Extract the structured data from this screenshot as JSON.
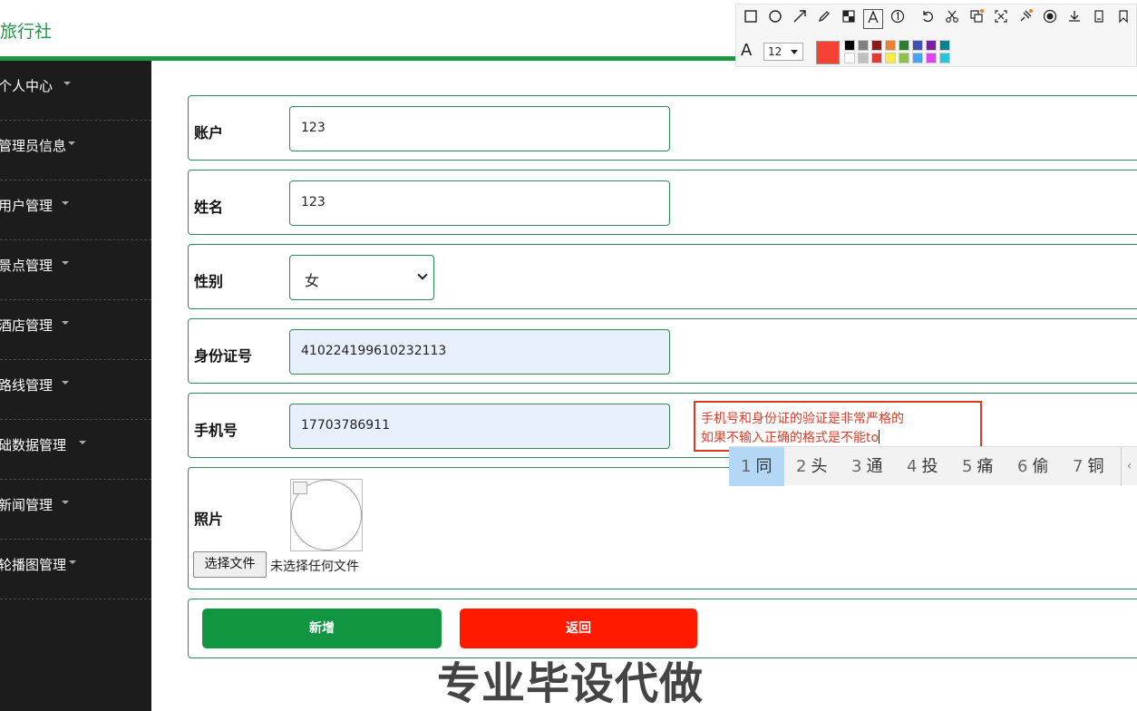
{
  "header": {
    "brand": "旅行社",
    "accent_color": "#1f9646"
  },
  "sidebar": {
    "items": [
      {
        "label": "个人中心"
      },
      {
        "label": "管理员信息"
      },
      {
        "label": "用户管理"
      },
      {
        "label": "景点管理"
      },
      {
        "label": "酒店管理"
      },
      {
        "label": "路线管理"
      },
      {
        "label": "础数据管理"
      },
      {
        "label": "新闻管理"
      },
      {
        "label": "轮播图管理"
      }
    ]
  },
  "form": {
    "account": {
      "label": "账户",
      "value": "123"
    },
    "name": {
      "label": "姓名",
      "value": "123"
    },
    "gender": {
      "label": "性别",
      "value": "女"
    },
    "id_number": {
      "label": "身份证号",
      "value": "410224199610232113"
    },
    "phone": {
      "label": "手机号",
      "value": "17703786911"
    },
    "photo": {
      "label": "照片",
      "file_button": "选择文件",
      "file_status": "未选择任何文件"
    },
    "buttons": {
      "add": "新增",
      "back": "返回",
      "add_color": "#129540",
      "back_color": "#ff1a00"
    }
  },
  "annotation": {
    "line1": "手机号和身份证的验证是非常严格的",
    "line2": "如果不输入正确的格式是不能to",
    "color": "#d83a26"
  },
  "ime": {
    "candidates": [
      {
        "num": "1",
        "char": "同"
      },
      {
        "num": "2",
        "char": "头"
      },
      {
        "num": "3",
        "char": "通"
      },
      {
        "num": "4",
        "char": "投"
      },
      {
        "num": "5",
        "char": "痛"
      },
      {
        "num": "6",
        "char": "偷"
      },
      {
        "num": "7",
        "char": "铜"
      }
    ],
    "prev_arrow": "‹"
  },
  "toolbar": {
    "font_size": "12",
    "font_icon": "A",
    "current_color": "#f44336",
    "tools": [
      "rectangle-icon",
      "circle-icon",
      "arrow-icon",
      "pencil-icon",
      "mosaic-icon",
      "text-icon",
      "number-icon",
      "undo-icon",
      "cut-icon",
      "translate-icon",
      "ocr-icon",
      "pin-icon",
      "record-icon",
      "download-icon",
      "copy-icon",
      "bookmark-icon"
    ],
    "palette_top": [
      "#000000",
      "#808080",
      "#8b1a1a",
      "#f08030",
      "#2e7d32",
      "#3f51b5",
      "#7b1fa2",
      "#00838f"
    ],
    "palette_bottom": [
      "#ffffff",
      "#c0c0c0",
      "#e53935",
      "#ffeb3b",
      "#8bc34a",
      "#42a5f5",
      "#e040fb",
      "#26c6da"
    ]
  },
  "watermark": {
    "text": "专业毕设代做"
  }
}
